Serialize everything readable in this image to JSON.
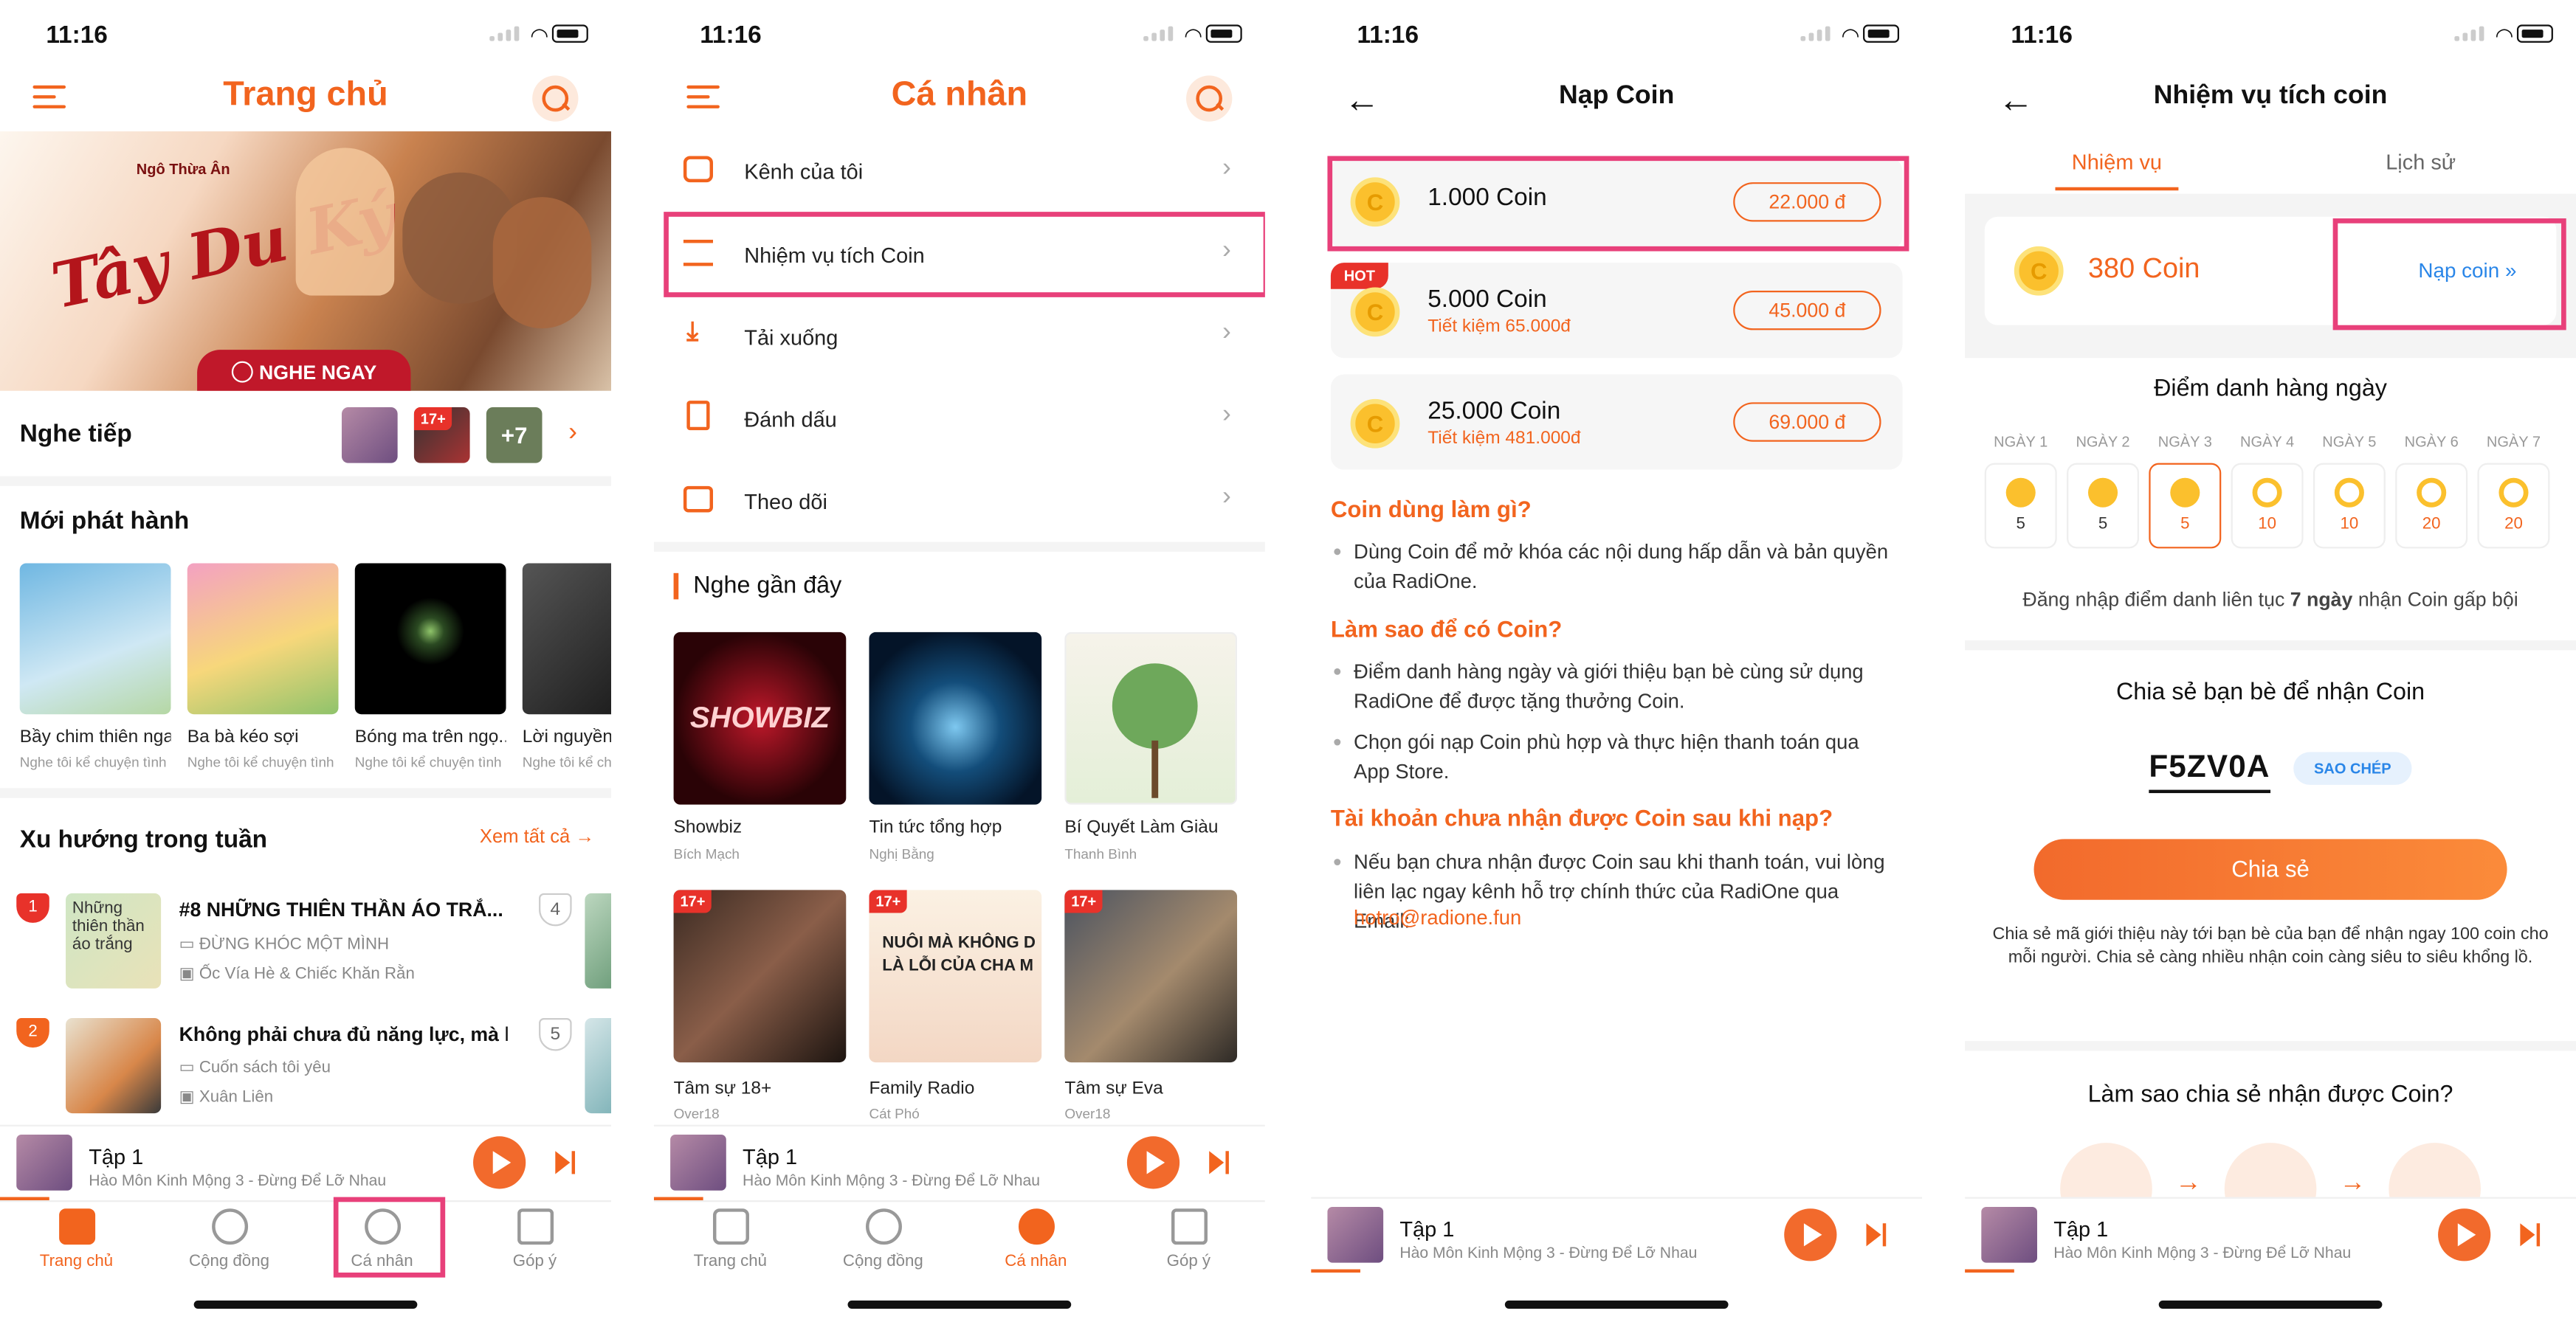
{
  "status_time": "11:16",
  "screen1": {
    "title": "Trang chủ",
    "banner": {
      "small_text": "Ngô Thừa Ân",
      "cta": "NGHE NGAY"
    },
    "continue_label": "Nghe tiếp",
    "continue_thumb_tag": "17+",
    "continue_more": "+7",
    "new_release_title": "Mới phát hành",
    "new_releases": [
      {
        "title": "Bầy chim thiên nga",
        "sub": "Nghe tôi kể chuyện tình"
      },
      {
        "title": "Ba bà kéo sợi",
        "sub": "Nghe tôi kể chuyện tình"
      },
      {
        "title": "Bóng ma trên ngọ...",
        "sub": "Nghe tôi kể chuyện tình"
      },
      {
        "title": "Lời nguyền n",
        "sub": "Nghe tôi kể chu"
      }
    ],
    "trending_title": "Xu hướng trong tuần",
    "see_all": "Xem tất cả",
    "trending": [
      {
        "rank": "1",
        "title": "#8 NHỮNG THIÊN THẦN ÁO TRẮ...",
        "sub1": "ĐỪNG KHÓC MỘT MÌNH",
        "sub2": "Ốc Vía Hè & Chiếc Khăn Rằn",
        "next_rank": "4"
      },
      {
        "rank": "2",
        "title": "Không phải chưa đủ năng lực, mà l...",
        "sub1": "Cuốn sách tôi yêu",
        "sub2": "Xuân Liên",
        "next_rank": "5"
      }
    ],
    "thumb_text_1": "Những thiên thần áo trắng"
  },
  "screen2": {
    "title": "Cá nhân",
    "menu": [
      "Kênh của tôi",
      "Nhiệm vụ tích Coin",
      "Tải xuống",
      "Đánh dấu",
      "Theo dõi"
    ],
    "recent_title": "Nghe gần đây",
    "recent": [
      {
        "title": "Showbiz",
        "sub": "Bích Mạch",
        "tag": "",
        "art": "SHOWBIZ"
      },
      {
        "title": "Tin tức tổng hợp",
        "sub": "Nghị Bằng",
        "tag": "",
        "art": ""
      },
      {
        "title": "Bí Quyết Làm Giàu",
        "sub": "Thanh Bình",
        "tag": "",
        "art": ""
      },
      {
        "title": "Tâm sự 18+",
        "sub": "Over18",
        "tag": "17+",
        "art": ""
      },
      {
        "title": "Family Radio",
        "sub": "Cát Phó",
        "tag": "17+",
        "art": "NUÔI MÀ KHÔNG D LÀ LỖI CỦA CHA M"
      },
      {
        "title": "Tâm sự Eva",
        "sub": "Over18",
        "tag": "17+",
        "art": ""
      }
    ]
  },
  "screen3": {
    "title": "Nạp Coin",
    "packages": [
      {
        "coins": "1.000 Coin",
        "save": "",
        "price": "22.000 đ",
        "hot": ""
      },
      {
        "coins": "5.000 Coin",
        "save": "Tiết kiệm 65.000đ",
        "price": "45.000 đ",
        "hot": "HOT"
      },
      {
        "coins": "25.000 Coin",
        "save": "Tiết kiệm 481.000đ",
        "price": "69.000 đ",
        "hot": ""
      }
    ],
    "faq": [
      {
        "q": "Coin dùng làm gì?",
        "a": [
          "Dùng Coin để mở khóa các nội dung hấp dẫn và bản quyền của RadiOne."
        ]
      },
      {
        "q": "Làm sao để có Coin?",
        "a": [
          "Điểm danh hàng ngày và giới thiệu bạn bè cùng sử dụng RadiOne để được tặng thưởng Coin.",
          "Chọn gói nạp Coin phù hợp và thực hiện thanh toán qua App Store."
        ]
      },
      {
        "q": "Tài khoản chưa nhận được Coin sau khi nạp?",
        "a": [
          "Nếu bạn chưa nhận được Coin sau khi thanh toán, vui lòng liên lạc ngay kênh hỗ trợ chính thức của RadiOne qua Email:"
        ]
      }
    ],
    "email": "hotro@radione.fun"
  },
  "screen4": {
    "title": "Nhiệm vụ tích coin",
    "tabs": [
      "Nhiệm vụ",
      "Lịch sử"
    ],
    "balance": "380 Coin",
    "topup": "Nạp coin",
    "daily_title": "Điểm danh hàng ngày",
    "days": [
      {
        "label": "NGÀY 1",
        "value": "5",
        "state": "done"
      },
      {
        "label": "NGÀY 2",
        "value": "5",
        "state": "done"
      },
      {
        "label": "NGÀY 3",
        "value": "5",
        "state": "today"
      },
      {
        "label": "NGÀY 4",
        "value": "10",
        "state": "todo"
      },
      {
        "label": "NGÀY 5",
        "value": "10",
        "state": "todo"
      },
      {
        "label": "NGÀY 6",
        "value": "20",
        "state": "todo"
      },
      {
        "label": "NGÀY 7",
        "value": "20",
        "state": "todo"
      }
    ],
    "streak_pre": "Đăng nhập điểm danh liên tục",
    "streak_bold": "7 ngày",
    "streak_post": "nhận Coin gấp bội",
    "share_title": "Chia sẻ bạn bè để nhận Coin",
    "code": "F5ZV0A",
    "copy": "SAO CHÉP",
    "share_btn": "Chia sẻ",
    "share_note": "Chia sẻ mã giới thiệu này tới bạn bè của bạn để nhận ngay 100 coin cho mỗi người. Chia sẻ càng nhiều nhận coin càng siêu to siêu khổng lồ.",
    "how_title": "Làm sao chia sẻ nhận được Coin?"
  },
  "player": {
    "title": "Tập 1",
    "sub": "Hào Môn Kinh Mộng 3 - Đừng Để Lỡ Nhau"
  },
  "tabs": [
    "Trang chủ",
    "Cộng đồng",
    "Cá nhân",
    "Góp ý"
  ],
  "colors": {
    "accent": "#f2641e",
    "highlight": "#e8407a",
    "coin": "#fbc02d"
  }
}
